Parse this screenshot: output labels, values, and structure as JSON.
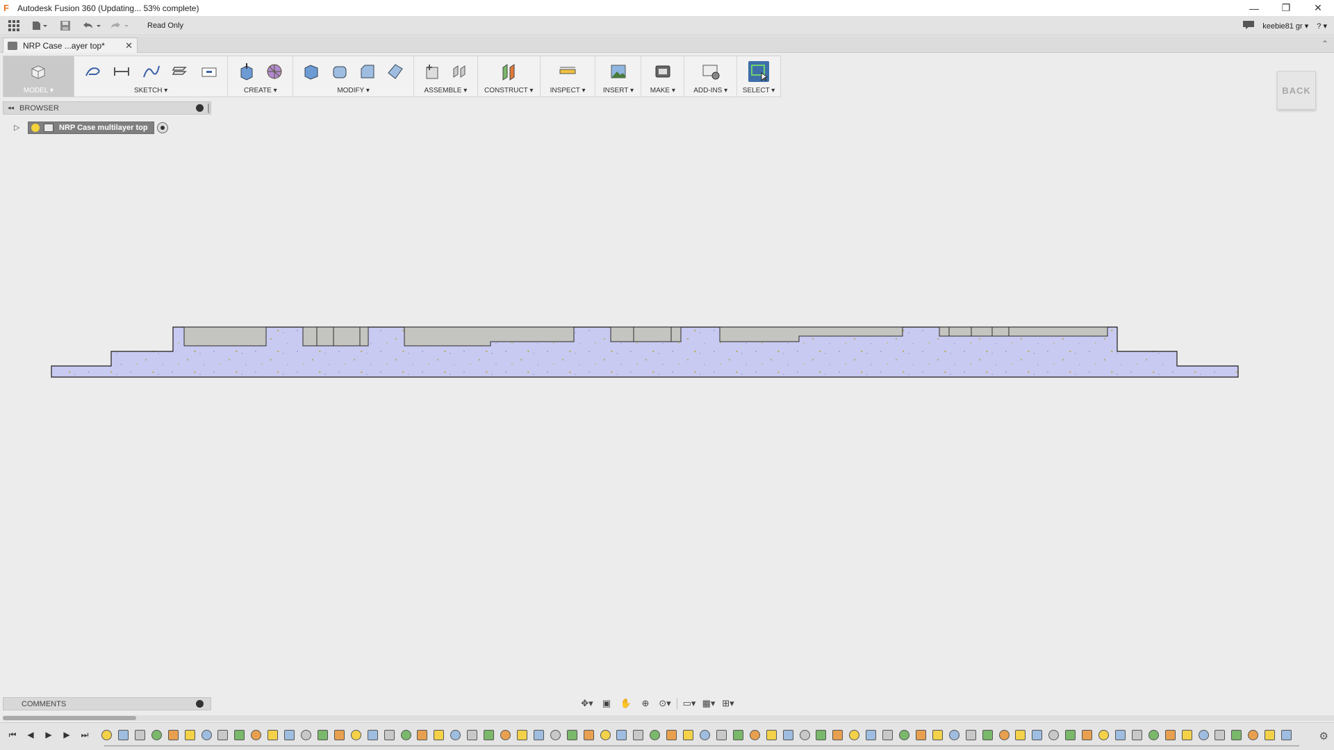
{
  "window": {
    "title": "Autodesk Fusion 360  (Updating... 53% complete)",
    "update_progress_percent": 53,
    "controls": {
      "minimize": "—",
      "restore": "❐",
      "close": "✕"
    }
  },
  "quick_access": {
    "read_only_label": "Read Only",
    "user_label": "keebie81 gr ▾",
    "help_label": "? ▾"
  },
  "document_tab": {
    "title": "NRP Case ...ayer top*",
    "close": "✕"
  },
  "toolbar": {
    "workspace_label": "MODEL ▾",
    "groups": [
      {
        "label": "SKETCH ▾"
      },
      {
        "label": "CREATE ▾"
      },
      {
        "label": "MODIFY ▾"
      },
      {
        "label": "ASSEMBLE ▾"
      },
      {
        "label": "CONSTRUCT ▾"
      },
      {
        "label": "INSPECT ▾"
      },
      {
        "label": "INSERT ▾"
      },
      {
        "label": "MAKE ▾"
      },
      {
        "label": "ADD-INS ▾"
      },
      {
        "label": "SELECT ▾"
      }
    ]
  },
  "back_button_label": "BACK",
  "browser": {
    "header": "BROWSER",
    "root_node": "NRP Case multilayer top"
  },
  "comments": {
    "header": "COMMENTS"
  },
  "colors": {
    "model_fill": "#c8c9f2",
    "model_outline": "#1b1b1b",
    "selected_tool": "#3f6fa9",
    "light_bulb": "#f4d23a"
  },
  "timeline": {
    "feature_count": 72
  }
}
